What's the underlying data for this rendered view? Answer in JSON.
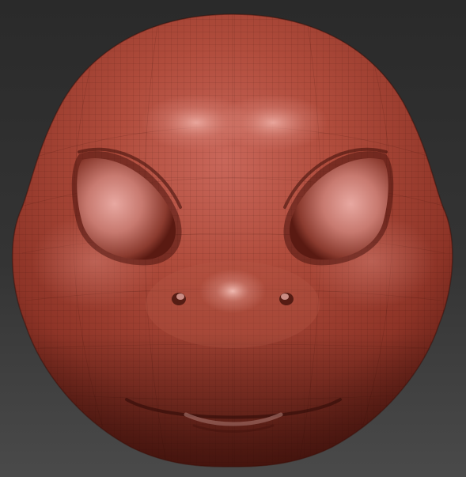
{
  "viewport": {
    "background_top": "#2a2a2a",
    "background_bottom": "#4a4a4a"
  },
  "model": {
    "name": "creature-head-sculpt",
    "material_color": "#a84232",
    "material_highlight": "#e8a39a",
    "material_shadow": "#4a140e",
    "wireframe_visible": true,
    "wire_color": "#2b0a06"
  }
}
